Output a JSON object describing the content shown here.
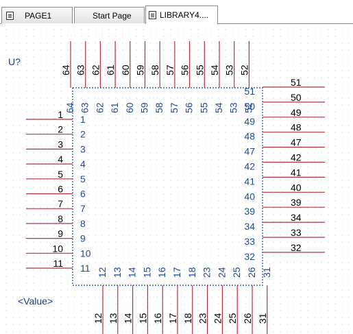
{
  "tabs": [
    {
      "label": "PAGE1",
      "icon": "page-icon",
      "active": false
    },
    {
      "label": "Start Page",
      "icon": "",
      "active": false
    },
    {
      "label": "LIBRARY4....",
      "icon": "library-part-icon",
      "active": true
    }
  ],
  "part": {
    "reference": "U?",
    "value": "<Value>",
    "colors": {
      "pin": "#b2323c",
      "outline": "#1a4a9a",
      "pin_name": "#1a4a9a",
      "pin_number": "#000000"
    },
    "left_pins": [
      "1",
      "2",
      "3",
      "4",
      "5",
      "6",
      "7",
      "8",
      "9",
      "10",
      "11"
    ],
    "left_pin_names": [
      "1",
      "2",
      "3",
      "4",
      "5",
      "6",
      "7",
      "8",
      "9",
      "10",
      "11"
    ],
    "bottom_pins": [
      "12",
      "13",
      "14",
      "15",
      "16",
      "17",
      "18",
      "23",
      "24",
      "25",
      "26",
      "31"
    ],
    "bottom_pin_names": [
      "12",
      "13",
      "14",
      "15",
      "16",
      "17",
      "18",
      "23",
      "24",
      "25",
      "26",
      "31"
    ],
    "right_pins": [
      "51",
      "50",
      "49",
      "48",
      "47",
      "42",
      "41",
      "40",
      "39",
      "34",
      "33",
      "32"
    ],
    "right_pin_names": [
      "51",
      "50",
      "49",
      "48",
      "47",
      "42",
      "41",
      "40",
      "39",
      "34",
      "33",
      "32"
    ],
    "top_pins": [
      "64",
      "63",
      "62",
      "61",
      "60",
      "59",
      "58",
      "57",
      "56",
      "55",
      "54",
      "53",
      "52"
    ],
    "top_pin_names": [
      "64",
      "63",
      "62",
      "61",
      "60",
      "59",
      "58",
      "57",
      "56",
      "55",
      "54",
      "53",
      "52"
    ]
  }
}
